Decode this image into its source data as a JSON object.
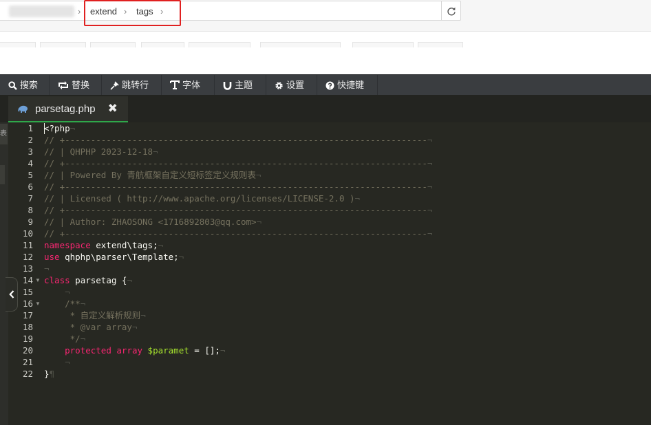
{
  "address_bar": {
    "crumbs": [
      "extend",
      "tags"
    ],
    "separator": "›"
  },
  "toolbar": {
    "items": [
      {
        "label": "搜索",
        "icon": "search-icon"
      },
      {
        "label": "替换",
        "icon": "replace-icon"
      },
      {
        "label": "跳转行",
        "icon": "pin-icon"
      },
      {
        "label": "字体",
        "icon": "font-icon"
      },
      {
        "label": "主题",
        "icon": "magnet-icon"
      },
      {
        "label": "设置",
        "icon": "gear-icon"
      },
      {
        "label": "快捷键",
        "icon": "help-icon"
      }
    ]
  },
  "tab": {
    "title": "parsetag.php",
    "close": "✖",
    "icon": "php-elephant-icon"
  },
  "sidebar": {
    "fragment": "表"
  },
  "editor": {
    "line_numbers": [
      "1",
      "2",
      "3",
      "4",
      "5",
      "6",
      "7",
      "8",
      "9",
      "10",
      "11",
      "12",
      "13",
      "14",
      "15",
      "16",
      "17",
      "18",
      "19",
      "20",
      "21",
      "22"
    ],
    "lines": [
      {
        "t": "<?php"
      },
      {
        "t": "// +----------------------------------------------------------------------"
      },
      {
        "t": "// | QHPHP 2023-12-18"
      },
      {
        "t": "// +----------------------------------------------------------------------"
      },
      {
        "t": "// | Powered By 青航框架自定义短标签定义规则表"
      },
      {
        "t": "// +----------------------------------------------------------------------"
      },
      {
        "t": "// | Licensed ( http://www.apache.org/licenses/LICENSE-2.0 )"
      },
      {
        "t": "// +----------------------------------------------------------------------"
      },
      {
        "t": "// | Author: ZHAOSONG <1716892803@qq.com>"
      },
      {
        "t": "// +----------------------------------------------------------------------"
      },
      {
        "kw": "namespace",
        "t": " extend\\tags;"
      },
      {
        "kw": "use",
        "t": " qhphp\\parser\\Template;"
      },
      {
        "t": ""
      },
      {
        "kw": "class",
        "t": " parsetag {"
      },
      {
        "t": "    "
      },
      {
        "t": "    /**"
      },
      {
        "t": "     * 自定义解析规则"
      },
      {
        "t": "     * @var array"
      },
      {
        "t": "     */"
      },
      {
        "t": "    protected array $paramet = [];"
      },
      {
        "t": "    "
      },
      {
        "t": "}"
      }
    ]
  },
  "colors": {
    "editor_bg": "#272822",
    "comment": "#75715e",
    "keyword": "#f92672",
    "variable": "#a6e22e",
    "text": "#f8f8f2",
    "tab_accent": "#2fa84a",
    "highlight_box": "#e02020"
  }
}
